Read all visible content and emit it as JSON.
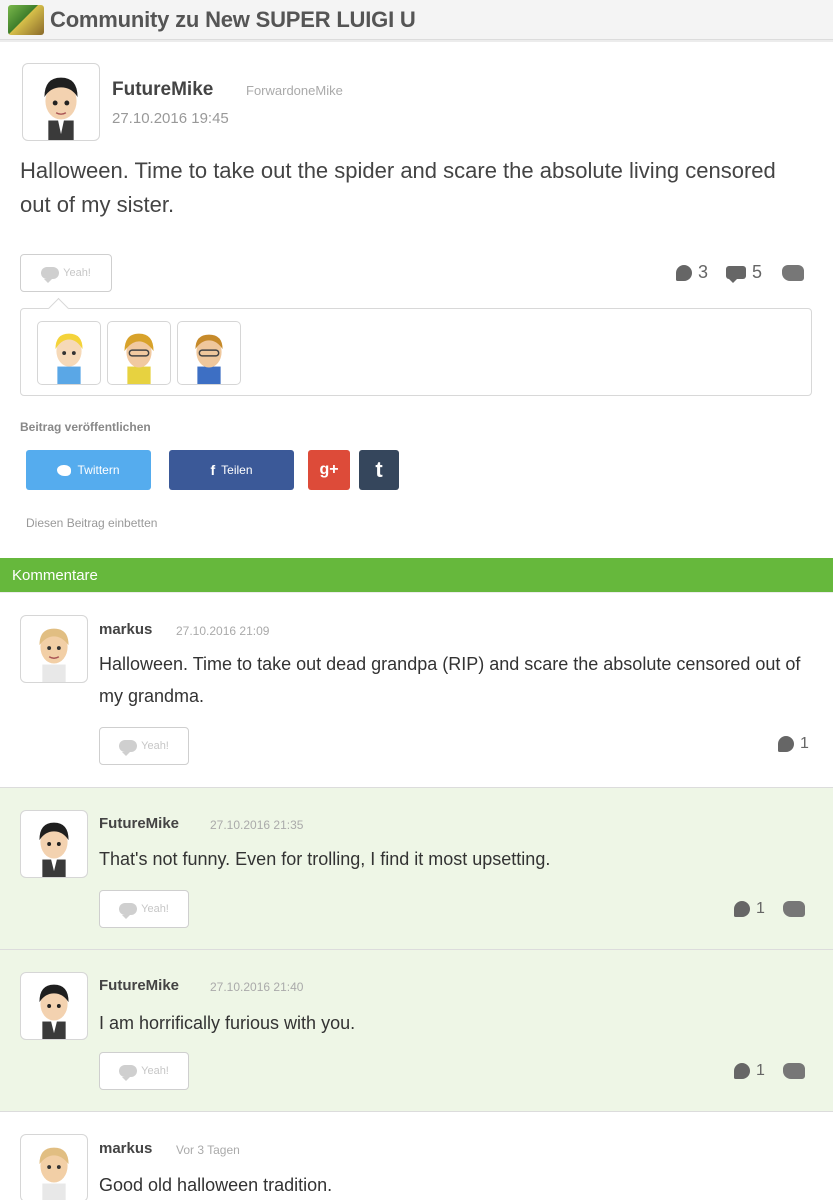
{
  "header": {
    "title": "Community zu New SUPER LUIGI U",
    "icon": "game-icon"
  },
  "post": {
    "author": "FutureMike",
    "handle": "ForwardoneMike",
    "timestamp": "27.10.2016 19:45",
    "body": "Halloween. Time to take out the spider and scare the absolute living censored out of my sister.",
    "yeah_label": "Yeah!",
    "yeah_count": "3",
    "comment_count": "5",
    "share_label": "Beitrag veröffentlichen",
    "twitter_label": "Twittern",
    "facebook_label": "Teilen",
    "google_label": "g+",
    "tumblr_label": "t",
    "embed_label": "Diesen Beitrag einbetten"
  },
  "comments_label": "Kommentare",
  "comments": [
    {
      "author": "markus",
      "timestamp": "27.10.2016 21:09",
      "body": "Halloween. Time to take out dead grandpa (RIP) and scare the absolute censored out of my grandma.",
      "yeah_label": "Yeah!",
      "yeah_count": "1"
    },
    {
      "author": "FutureMike",
      "timestamp": "27.10.2016 21:35",
      "body": "That's not funny. Even for trolling, I find it most upsetting.",
      "yeah_label": "Yeah!",
      "yeah_count": "1"
    },
    {
      "author": "FutureMike",
      "timestamp": "27.10.2016 21:40",
      "body": "I am horrifically furious with you.",
      "yeah_label": "Yeah!",
      "yeah_count": "1"
    },
    {
      "author": "markus",
      "timestamp": "Vor 3 Tagen",
      "body": "Good old halloween tradition."
    }
  ],
  "colors": {
    "accent_green": "#66b83c",
    "twitter": "#55acee",
    "facebook": "#3b5998",
    "google": "#dd4b39",
    "tumblr": "#35465c"
  }
}
